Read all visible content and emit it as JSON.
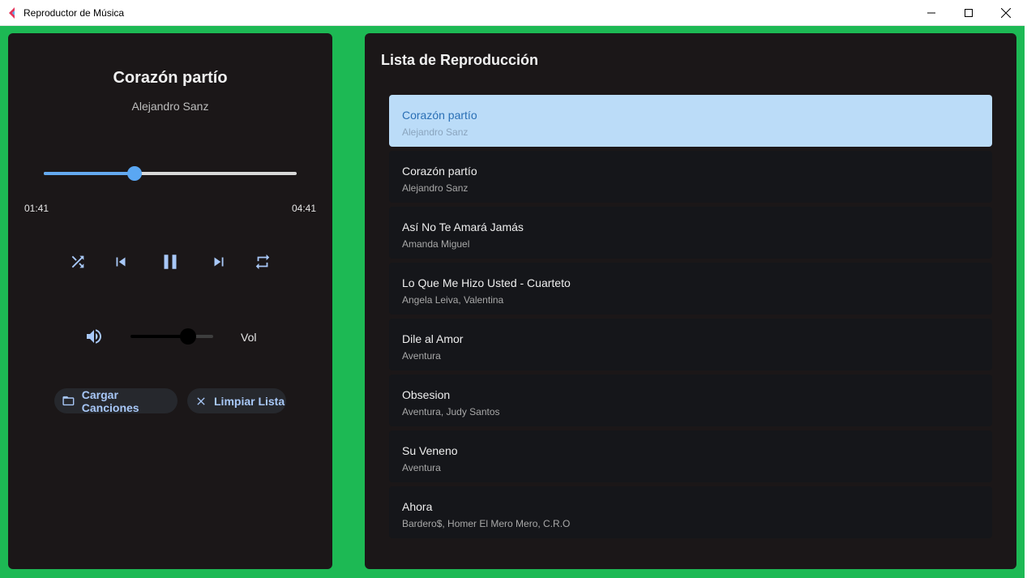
{
  "window": {
    "title": "Reproductor de Música",
    "accent": "#1db954"
  },
  "player": {
    "title": "Corazón partío",
    "artist": "Alejandro Sanz",
    "current_time": "01:41",
    "total_time": "04:41",
    "progress": 0.36,
    "volume_label": "Vol",
    "volume": 0.7,
    "controls": [
      "shuffle-icon",
      "previous-icon",
      "pause-icon",
      "next-icon",
      "repeat-icon"
    ],
    "load_button": "Cargar Canciones",
    "clear_button": "Limpiar Lista"
  },
  "playlist": {
    "heading": "Lista de Reproducción",
    "tracks": [
      {
        "title": "Corazón partío",
        "artist": "Alejandro Sanz",
        "active": true
      },
      {
        "title": "Corazón partío",
        "artist": "Alejandro Sanz"
      },
      {
        "title": "Así No Te Amará Jamás",
        "artist": "Amanda Miguel"
      },
      {
        "title": "Lo Que Me Hizo Usted - Cuarteto",
        "artist": "Angela Leiva, Valentina"
      },
      {
        "title": "Dile al Amor",
        "artist": "Aventura"
      },
      {
        "title": "Obsesion",
        "artist": "Aventura, Judy Santos"
      },
      {
        "title": "Su Veneno",
        "artist": "Aventura"
      },
      {
        "title": "Ahora",
        "artist": "Bardero$, Homer El Mero Mero, C.R.O"
      }
    ]
  }
}
